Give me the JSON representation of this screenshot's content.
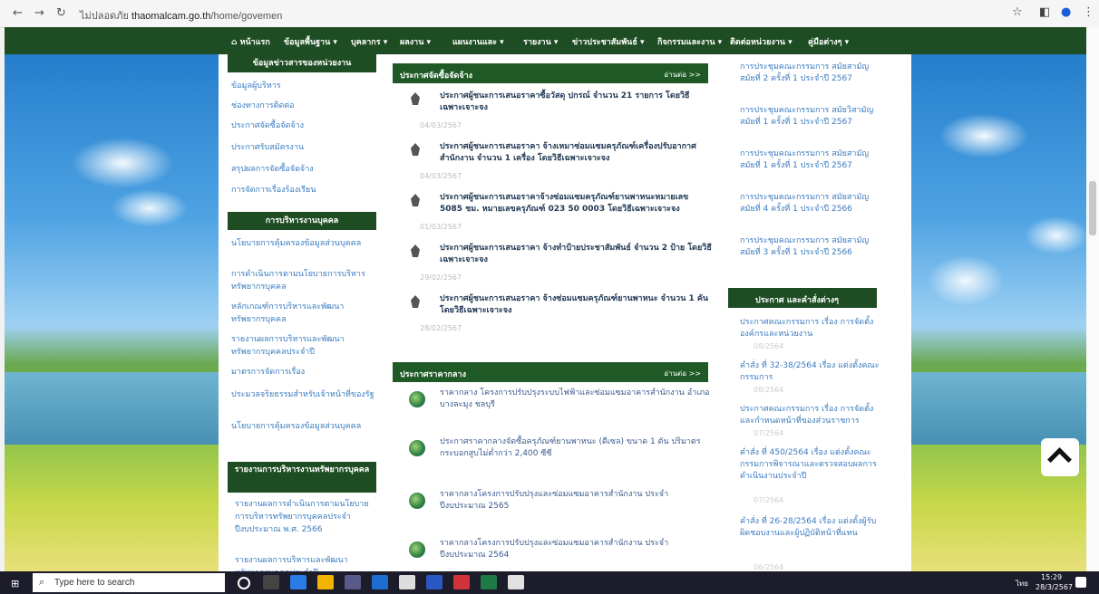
{
  "browser": {
    "back": "←",
    "forward": "→",
    "reload": "↻",
    "secure_label": "ไม่ปลอดภัย",
    "url_host": "thaomalcam.go.th",
    "url_path": "/home/govemen",
    "star": "☆",
    "ext": "◧",
    "profile": "●",
    "menu": "⋮"
  },
  "topnav": {
    "home": "หน้าแรก",
    "items": [
      "ข้อมูลพื้นฐาน ▾",
      "บุคลากร ▾",
      "ผลงาน ▾",
      "แผนงานและ ▾",
      "รายงาน ▾",
      "ข่าวประชาสัมพันธ์ ▾",
      "กิจกรรมและงาน ▾",
      "ติดต่อหน่วยงาน ▾",
      "คู่มือต่างๆ ▾"
    ]
  },
  "left": {
    "title1": "ข้อมูลข่าวสารของหน่วยงาน",
    "links1": [
      "ข้อมูลผู้บริหาร",
      "ช่องทางการติดต่อ",
      "ประกาศจัดซื้อจัดจ้าง",
      "ประกาศรับสมัครงาน",
      "สรุปผลการจัดซื้อจัดจ้าง",
      "การจัดการเรื่องร้องเรียน"
    ],
    "title2": "การบริหารงานบุคคล",
    "links2": [
      "นโยบายการคุ้มครองข้อมูลส่วนบุคคล",
      "การดำเนินการตามนโยบายการบริหารทรัพยากรบุคคล",
      "หลักเกณฑ์การบริหารและพัฒนาทรัพยากรบุคคล",
      "รายงานผลการบริหารและพัฒนาทรัพยากรบุคคลประจำปี",
      "มาตรการจัดการเรื่อง",
      "ประมวลจริยธรรมสำหรับเจ้าหน้าที่ของรัฐ",
      "นโยบายการคุ้มครองข้อมูลส่วนบุคคล"
    ],
    "title3": "รายงานการบริหารงานทรัพยากรบุคคล",
    "links3": [
      "รายงานผลการดำเนินการตามนโยบายการบริหารทรัพยากรบุคคลประจำปีงบประมาณ พ.ศ. 2566",
      "รายงานผลการบริหารและพัฒนาทรัพยากรบุคคลประจำปี"
    ]
  },
  "center": {
    "box1_title": "ประกาศจัดซื้อจัดจ้าง",
    "box1_more": "อ่านต่อ >>",
    "procurement": [
      {
        "title": "ประกาศผู้ชนะการเสนอราคาซื้อวัสดุ ปกรณ์ จำนวน 21 รายการ โดยวิธีเฉพาะเจาะจง",
        "date": "04/03/2567"
      },
      {
        "title": "ประกาศผู้ชนะการเสนอราคา จ้างเหมาซ่อมแซมครุภัณฑ์เครื่องปรับอากาศ สำนักงาน จำนวน 1 เครื่อง โดยวิธีเฉพาะเจาะจง",
        "date": "04/03/2567"
      },
      {
        "title": "ประกาศผู้ชนะการเสนอราคาจ้างซ่อมแซมครุภัณฑ์ยานพาหนะหมายเลข 5085 ชม. หมายเลขครุภัณฑ์ 023 50 0003 โดยวิธีเฉพาะเจาะจง",
        "date": "01/03/2567"
      },
      {
        "title": "ประกาศผู้ชนะการเสนอราคา จ้างทำป้ายประชาสัมพันธ์ จำนวน 2 ป้าย โดยวิธีเฉพาะเจาะจง",
        "date": "29/02/2567"
      },
      {
        "title": "ประกาศผู้ชนะการเสนอราคา จ้างซ่อมแซมครุภัณฑ์ยานพาหนะ จำนวน 1 คัน โดยวิธีเฉพาะเจาะจง",
        "date": "28/02/2567"
      }
    ],
    "box2_title": "ประกาศราคากลาง",
    "box2_more": "อ่านต่อ >>",
    "prices": [
      "ราคากลาง โครงการปรับปรุงระบบไฟฟ้าและซ่อมแซมอาคารสำนักงาน อำเภอบางละมุง ชลบุรี",
      "ประกาศราคากลางจัดซื้อครุภัณฑ์ยานพาหนะ (ดีเซล) ขนาด 1 ตัน ปริมาตรกระบอกสูบไม่ต่ำกว่า 2,400 ซีซี",
      "ราคากลางโครงการปรับปรุงและซ่อมแซมอาคารสำนักงาน ประจำปีงบประมาณ 2565",
      "ราคากลางโครงการปรับปรุงและซ่อมแซมอาคารสำนักงาน ประจำปีงบประมาณ 2564"
    ]
  },
  "right": {
    "meetings": [
      "การประชุมคณะกรรมการ สมัยสามัญ สมัยที่ 2 ครั้งที่ 1 ประจำปี 2567",
      "การประชุมคณะกรรมการ สมัยวิสามัญ สมัยที่ 1 ครั้งที่ 1 ประจำปี 2567",
      "การประชุมคณะกรรมการ สมัยสามัญ สมัยที่ 1 ครั้งที่ 1 ประจำปี 2567",
      "การประชุมคณะกรรมการ สมัยสามัญ สมัยที่ 4 ครั้งที่ 1 ประจำปี 2566",
      "การประชุมคณะกรรมการ สมัยสามัญ สมัยที่ 3 ครั้งที่ 1 ประจำปี 2566"
    ],
    "box_title": "ประกาศ และคำสั่งต่างๆ",
    "notices": [
      {
        "title": "ประกาศคณะกรรมการ เรื่อง การจัดตั้งองค์กรและหน่วยงาน",
        "date": "08/2564"
      },
      {
        "title": "คำสั่ง ที่ 32-38/2564 เรื่อง แต่งตั้งคณะกรรมการ",
        "date": "08/2564"
      },
      {
        "title": "ประกาศคณะกรรมการ เรื่อง การจัดตั้งและกำหนดหน้าที่ของส่วนราชการ",
        "date": "07/2564"
      },
      {
        "title": "คำสั่ง ที่ 450/2564 เรื่อง แต่งตั้งคณะกรรมการพิจารณาและตรวจสอบผลการดำเนินงานประจำปี",
        "date": "07/2564"
      },
      {
        "title": "คำสั่ง ที่ 26-28/2564 เรื่อง แต่งตั้งผู้รับผิดชอบงานและผู้ปฏิบัติหน้าที่แทน",
        "date": "06/2564"
      }
    ]
  },
  "taskbar": {
    "start": "⊞",
    "search_placeholder": "Type here to search",
    "search_icon": "⌕",
    "tray_time": "15:29",
    "tray_date": "28/3/2567",
    "tray_lang": "ไทย"
  }
}
